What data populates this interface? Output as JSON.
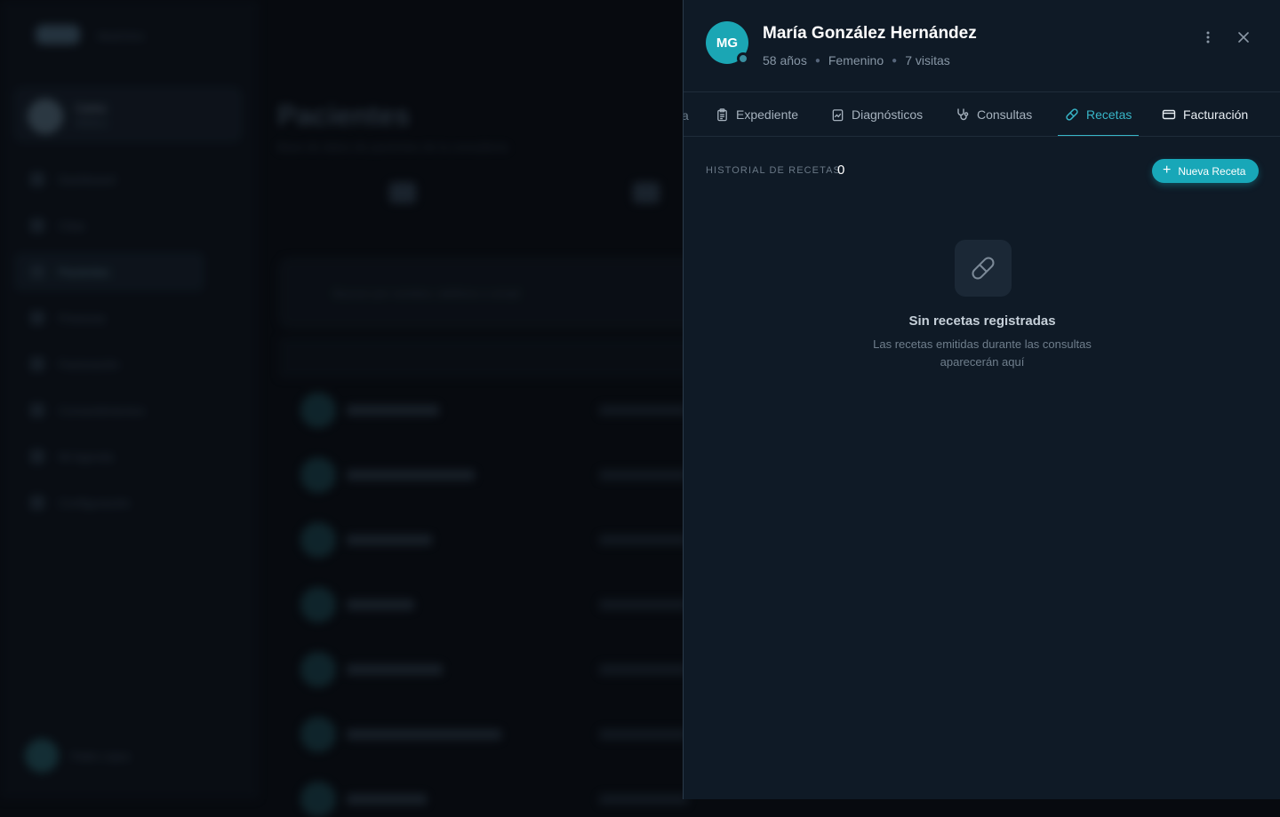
{
  "background": {
    "logo_text": "MedClinic",
    "user": {
      "name": "Carlos",
      "role": "Médico"
    },
    "nav": [
      "Dashboard",
      "Citas",
      "Pacientes",
      "Finanzas",
      "Facturación",
      "Consentimientos",
      "Mi Agenda",
      "Configuración"
    ],
    "page_title": "Pacientes",
    "page_subtitle": "Base de datos de pacientes de la consultoría",
    "search_placeholder": "Buscar por nombre, teléfono o email",
    "footer_user": "Pablo López"
  },
  "patient": {
    "initials": "MG",
    "name": "María González Hernández",
    "age": "58 años",
    "gender": "Femenino",
    "visits": "7 visitas"
  },
  "tabs": [
    {
      "label": "Expediente",
      "icon": "clipboard-icon"
    },
    {
      "label": "Diagnósticos",
      "icon": "file-chart-icon"
    },
    {
      "label": "Consultas",
      "icon": "stethoscope-icon"
    },
    {
      "label": "Recetas",
      "icon": "pill-icon"
    },
    {
      "label": "Facturación",
      "icon": "card-icon"
    }
  ],
  "active_tab": "Recetas",
  "prescriptions": {
    "section_label": "HISTORIAL DE RECETAS",
    "count": "0",
    "new_button": "Nueva Receta",
    "empty_title": "Sin recetas registradas",
    "empty_description": "Las recetas emitidas durante las consultas aparecerán aquí"
  },
  "colors": {
    "accent": "#18a7b8",
    "drawer_bg": "#0f1a26",
    "page_bg": "#070a0f"
  }
}
